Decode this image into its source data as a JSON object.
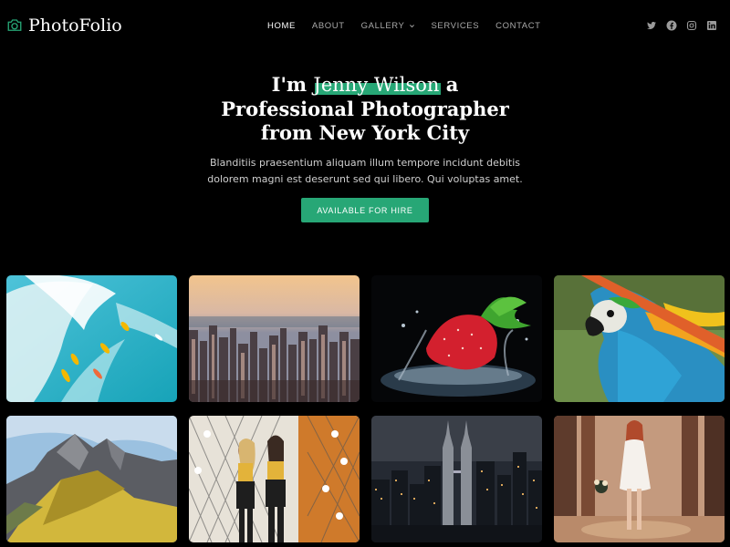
{
  "brand": {
    "name": "PhotoFolio",
    "icon": "camera-icon",
    "accent": "#27a776"
  },
  "nav": [
    {
      "label": "HOME",
      "active": true
    },
    {
      "label": "ABOUT"
    },
    {
      "label": "GALLERY",
      "dropdown": true
    },
    {
      "label": "SERVICES"
    },
    {
      "label": "CONTACT"
    }
  ],
  "socials": [
    "twitter-icon",
    "facebook-icon",
    "instagram-icon",
    "linkedin-icon"
  ],
  "hero": {
    "title_prefix": "I'm",
    "name": "Jenny Wilson",
    "title_suffix": "a",
    "title_line2": "Professional Photographer",
    "title_line3": "from New York City",
    "description_line1": "Blanditiis praesentium aliquam illum tempore incidunt debitis",
    "description_line2": "dolorem magni est deserunt sed qui libero. Qui voluptas amet.",
    "cta": "AVAILABLE FOR HIRE"
  },
  "gallery": [
    {
      "subject": "surfers-on-waves"
    },
    {
      "subject": "city-skyline"
    },
    {
      "subject": "strawberry-splash"
    },
    {
      "subject": "macaw-parrot"
    },
    {
      "subject": "mountain-peaks"
    },
    {
      "subject": "two-women-posing"
    },
    {
      "subject": "city-towers-at-night"
    },
    {
      "subject": "woman-in-forest"
    }
  ]
}
